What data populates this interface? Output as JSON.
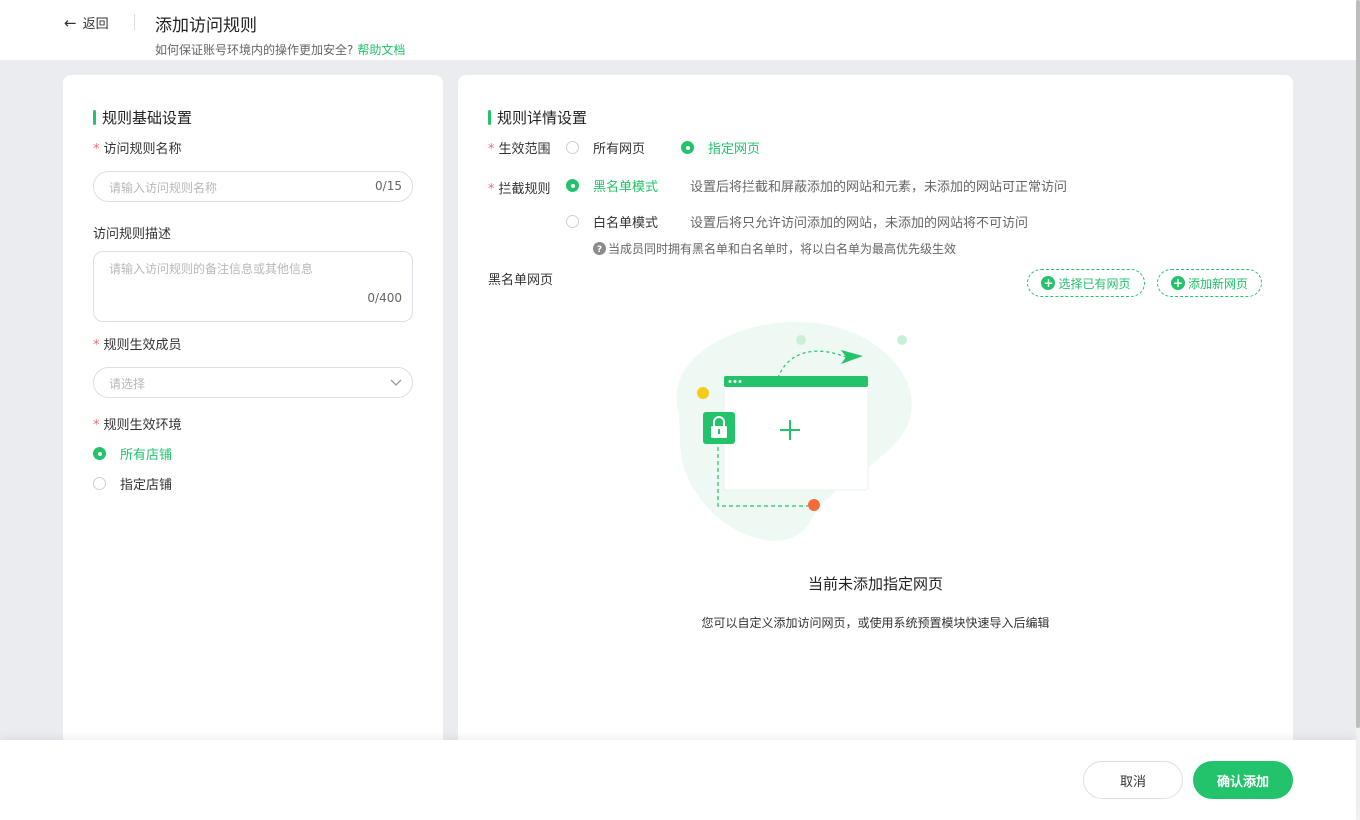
{
  "header": {
    "back_label": "返回",
    "title": "添加访问规则",
    "subtitle": "如何保证账号环境内的操作更加安全?",
    "help_link": "帮助文档"
  },
  "basic_settings": {
    "section_title": "规则基础设置",
    "name_label": "访问规则名称",
    "name_placeholder": "请输入访问规则名称",
    "name_counter": "0/15",
    "desc_label": "访问规则描述",
    "desc_placeholder": "请输入访问规则的备注信息或其他信息",
    "desc_counter": "0/400",
    "members_label": "规则生效成员",
    "members_placeholder": "请选择",
    "env_label": "规则生效环境",
    "env_options": [
      "所有店铺",
      "指定店铺"
    ],
    "env_selected": "所有店铺"
  },
  "detail_settings": {
    "section_title": "规则详情设置",
    "scope_label": "生效范围",
    "scope_options": [
      "所有网页",
      "指定网页"
    ],
    "scope_selected": "指定网页",
    "intercept_label": "拦截规则",
    "blacklist_label": "黑名单模式",
    "blacklist_desc": "设置后将拦截和屏蔽添加的网站和元素，未添加的网站可正常访问",
    "whitelist_label": "白名单模式",
    "whitelist_desc": "设置后将只允许访问添加的网站，未添加的网站将不可访问",
    "intercept_selected": "黑名单模式",
    "priority_note": "当成员同时拥有黑名单和白名单时，将以白名单为最高优先级生效",
    "list_label": "黑名单网页",
    "select_existing_label": "选择已有网页",
    "add_new_label": "添加新网页",
    "empty_title": "当前未添加指定网页",
    "empty_desc": "您可以自定义添加访问网页，或使用系统预置模块快速导入后编辑"
  },
  "footer": {
    "cancel_label": "取消",
    "confirm_label": "确认添加"
  },
  "colors": {
    "accent": "#22c36b",
    "required": "#f56c6c",
    "page_bg": "#ebecef"
  },
  "icons": [
    "arrow-left-icon",
    "question-circle-icon",
    "plus-circle-icon",
    "chevron-down-icon",
    "lock-icon",
    "paper-plane-icon"
  ]
}
